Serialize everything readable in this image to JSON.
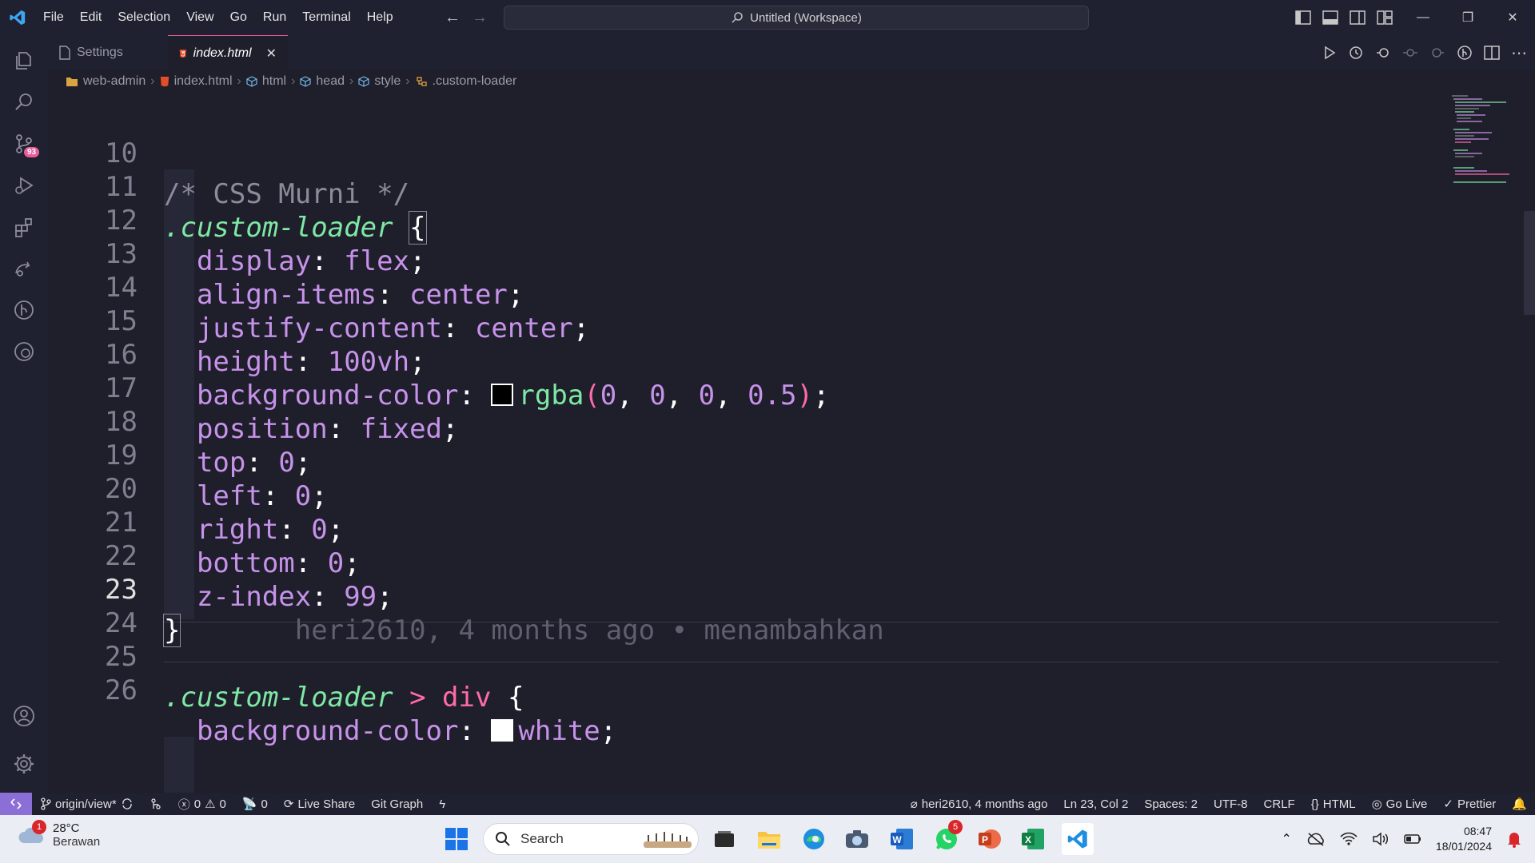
{
  "menu": [
    "File",
    "Edit",
    "Selection",
    "View",
    "Go",
    "Run",
    "Terminal",
    "Help"
  ],
  "command_center": "Untitled (Workspace)",
  "activity_badge": "93",
  "tabs": [
    {
      "label": "Settings"
    },
    {
      "label": "index.html"
    }
  ],
  "breadcrumb": [
    "web-admin",
    "index.html",
    "html",
    "head",
    "style",
    ".custom-loader"
  ],
  "editor": {
    "lines": [
      {
        "n": "10"
      },
      {
        "n": "11"
      },
      {
        "n": "12"
      },
      {
        "n": "13"
      },
      {
        "n": "14"
      },
      {
        "n": "15"
      },
      {
        "n": "16"
      },
      {
        "n": "17"
      },
      {
        "n": "18"
      },
      {
        "n": "19"
      },
      {
        "n": "20"
      },
      {
        "n": "21"
      },
      {
        "n": "22"
      },
      {
        "n": "23"
      },
      {
        "n": "24"
      },
      {
        "n": "25"
      },
      {
        "n": "26"
      }
    ],
    "comment": "/* CSS Murni */",
    "selector": ".custom-loader",
    "selector2": ".custom-loader",
    "child_tag": "div",
    "props": {
      "display": {
        "prop": "display",
        "val": "flex"
      },
      "align": {
        "prop": "align-items",
        "val": "center"
      },
      "justify": {
        "prop": "justify-content",
        "val": "center"
      },
      "height": {
        "prop": "height",
        "val": "100vh"
      },
      "bg": {
        "prop": "background-color",
        "fn": "rgba",
        "args": [
          "0",
          "0",
          "0",
          "0.5"
        ]
      },
      "position": {
        "prop": "position",
        "val": "fixed"
      },
      "top": {
        "prop": "top",
        "val": "0"
      },
      "left": {
        "prop": "left",
        "val": "0"
      },
      "right": {
        "prop": "right",
        "val": "0"
      },
      "bottom": {
        "prop": "bottom",
        "val": "0"
      },
      "zindex": {
        "prop": "z-index",
        "val": "99"
      },
      "bg2": {
        "prop": "background-color",
        "val": "white"
      }
    },
    "blame": "heri2610, 4 months ago • menambahkan",
    "swatch_colors": {
      "black": "#000000",
      "white": "#ffffff"
    }
  },
  "status": {
    "branch": "origin/view*",
    "errors": "0",
    "warnings": "0",
    "ports": "0",
    "live_share": "Live Share",
    "git_graph": "Git Graph",
    "blame": "heri2610, 4 months ago",
    "position": "Ln 23, Col 2",
    "spaces": "Spaces: 2",
    "encoding": "UTF-8",
    "eol": "CRLF",
    "language": "HTML",
    "go_live": "Go Live",
    "prettier": "Prettier"
  },
  "taskbar": {
    "weather_badge": "1",
    "temperature": "28°C",
    "condition": "Berawan",
    "search": "Search",
    "whatsapp_badge": "5",
    "time": "08:47",
    "date": "18/01/2024"
  },
  "colors": {
    "accent": "#e85d9b",
    "remote": "#8c6fd6",
    "selector": "#7ee8a4",
    "property": "#c792ea"
  }
}
